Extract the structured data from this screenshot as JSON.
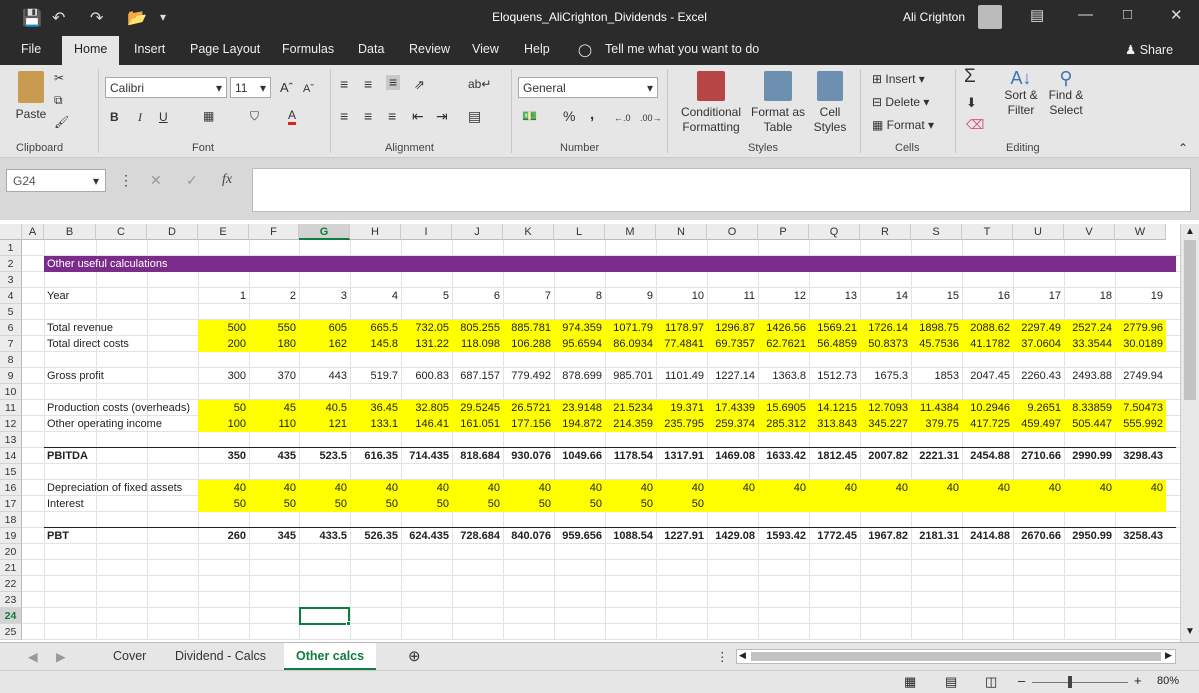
{
  "window": {
    "title": "Eloquens_AliCrighton_Dividends  -  Excel",
    "user": "Ali Crighton"
  },
  "ribbon_tabs": [
    "File",
    "Home",
    "Insert",
    "Page Layout",
    "Formulas",
    "Data",
    "Review",
    "View",
    "Help"
  ],
  "tell_me": "Tell me what you want to do",
  "share": "Share",
  "clipboard": {
    "paste": "Paste",
    "label": "Clipboard"
  },
  "font": {
    "name": "Calibri",
    "size": "11",
    "label": "Font",
    "bold": "B",
    "italic": "I",
    "underline": "U"
  },
  "alignment": {
    "label": "Alignment"
  },
  "number": {
    "format": "General",
    "label": "Number",
    "percent": "%",
    "comma": ","
  },
  "styles": {
    "label": "Styles",
    "conditional": "Conditional",
    "conditional2": "Formatting",
    "format_as": "Format as",
    "format_as2": "Table",
    "cell": "Cell",
    "cell2": "Styles"
  },
  "cells": {
    "label": "Cells",
    "insert": "Insert",
    "delete": "Delete",
    "format": "Format"
  },
  "editing": {
    "label": "Editing",
    "sort": "Sort &",
    "sort2": "Filter",
    "find": "Find &",
    "find2": "Select"
  },
  "formula": {
    "namebox": "G24",
    "fx": "fx",
    "content": ""
  },
  "columns": [
    "A",
    "B",
    "C",
    "D",
    "E",
    "F",
    "G",
    "H",
    "I",
    "J",
    "K",
    "L",
    "M",
    "N",
    "O",
    "P",
    "Q",
    "R",
    "S",
    "T",
    "U",
    "V",
    "W"
  ],
  "rows": [
    "1",
    "2",
    "3",
    "4",
    "5",
    "6",
    "7",
    "8",
    "9",
    "10",
    "11",
    "12",
    "13",
    "14",
    "15",
    "16",
    "17",
    "18",
    "19",
    "20",
    "21",
    "22",
    "23",
    "24",
    "25"
  ],
  "sheet": {
    "banner": "Other useful calculations",
    "year_label": "Year",
    "years": [
      "1",
      "2",
      "3",
      "4",
      "5",
      "6",
      "7",
      "8",
      "9",
      "10",
      "11",
      "12",
      "13",
      "14",
      "15",
      "16",
      "17",
      "18",
      "19"
    ],
    "total_revenue_label": "Total revenue",
    "total_revenue": [
      "500",
      "550",
      "605",
      "665.5",
      "732.05",
      "805.255",
      "885.781",
      "974.359",
      "1071.79",
      "1178.97",
      "1296.87",
      "1426.56",
      "1569.21",
      "1726.14",
      "1898.75",
      "2088.62",
      "2297.49",
      "2527.24",
      "2779.96"
    ],
    "total_direct_label": "Total direct costs",
    "total_direct": [
      "200",
      "180",
      "162",
      "145.8",
      "131.22",
      "118.098",
      "106.288",
      "95.6594",
      "86.0934",
      "77.4841",
      "69.7357",
      "62.7621",
      "56.4859",
      "50.8373",
      "45.7536",
      "41.1782",
      "37.0604",
      "33.3544",
      "30.0189"
    ],
    "gross_profit_label": "Gross profit",
    "gross_profit": [
      "300",
      "370",
      "443",
      "519.7",
      "600.83",
      "687.157",
      "779.492",
      "878.699",
      "985.701",
      "1101.49",
      "1227.14",
      "1363.8",
      "1512.73",
      "1675.3",
      "1853",
      "2047.45",
      "2260.43",
      "2493.88",
      "2749.94"
    ],
    "production_label": "Production costs (overheads)",
    "production": [
      "50",
      "45",
      "40.5",
      "36.45",
      "32.805",
      "29.5245",
      "26.5721",
      "23.9148",
      "21.5234",
      "19.371",
      "17.4339",
      "15.6905",
      "14.1215",
      "12.7093",
      "11.4384",
      "10.2946",
      "9.2651",
      "8.33859",
      "7.50473"
    ],
    "other_income_label": "Other operating income",
    "other_income": [
      "100",
      "110",
      "121",
      "133.1",
      "146.41",
      "161.051",
      "177.156",
      "194.872",
      "214.359",
      "235.795",
      "259.374",
      "285.312",
      "313.843",
      "345.227",
      "379.75",
      "417.725",
      "459.497",
      "505.447",
      "555.992"
    ],
    "pbitda_label": "PBITDA",
    "pbitda": [
      "350",
      "435",
      "523.5",
      "616.35",
      "714.435",
      "818.684",
      "930.076",
      "1049.66",
      "1178.54",
      "1317.91",
      "1469.08",
      "1633.42",
      "1812.45",
      "2007.82",
      "2221.31",
      "2454.88",
      "2710.66",
      "2990.99",
      "3298.43"
    ],
    "depreciation_label": "Depreciation of fixed assets",
    "depreciation": [
      "40",
      "40",
      "40",
      "40",
      "40",
      "40",
      "40",
      "40",
      "40",
      "40",
      "40",
      "40",
      "40",
      "40",
      "40",
      "40",
      "40",
      "40",
      "40"
    ],
    "interest_label": "Interest",
    "interest": [
      "50",
      "50",
      "50",
      "50",
      "50",
      "50",
      "50",
      "50",
      "50",
      "50"
    ],
    "pbt_label": "PBT",
    "pbt": [
      "260",
      "345",
      "433.5",
      "526.35",
      "624.435",
      "728.684",
      "840.076",
      "959.656",
      "1088.54",
      "1227.91",
      "1429.08",
      "1593.42",
      "1772.45",
      "1967.82",
      "2181.31",
      "2414.88",
      "2670.66",
      "2950.99",
      "3258.43"
    ]
  },
  "sheet_tabs": [
    "Cover",
    "Dividend - Calcs",
    "Other calcs"
  ],
  "status": {
    "zoom": "80%"
  },
  "colors": {
    "banner": "#7b2c8b",
    "input_fill": "#ffff00",
    "accent": "#107c41"
  }
}
